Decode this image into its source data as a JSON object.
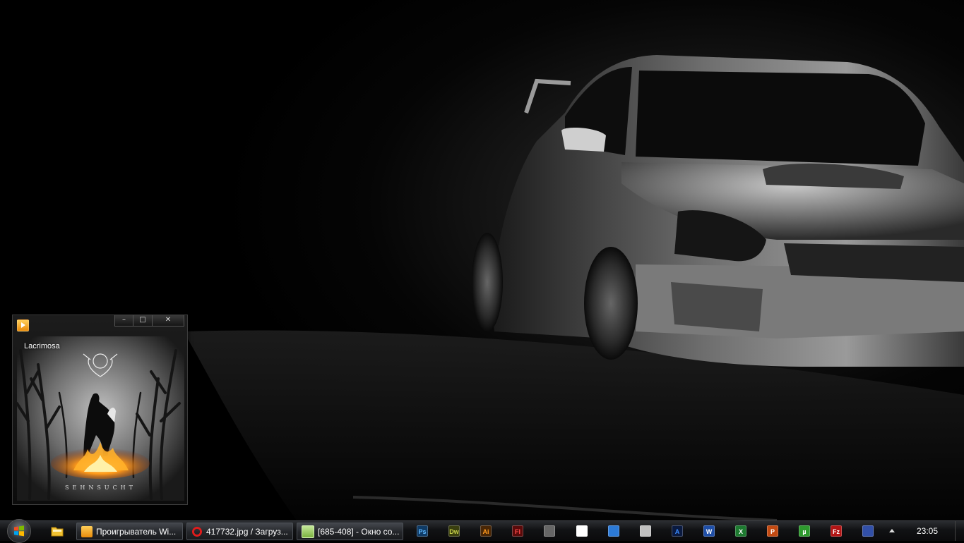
{
  "player": {
    "artist": "Lacrimosa",
    "album_title": "SEHNSUCHT",
    "controls": {
      "minimize": "–",
      "maximize": "□",
      "close": "✕"
    }
  },
  "taskbar": {
    "tasks": [
      {
        "label": "Проигрыватель Wi...",
        "icon": "media-player-icon",
        "color": "#f5a623"
      },
      {
        "label": "417732.jpg / Загруз...",
        "icon": "opera-icon",
        "color": "#e01b1b"
      },
      {
        "label": "[685-408] - Окно со...",
        "icon": "notepad-icon",
        "color": "#8bc34a"
      }
    ],
    "quick_icons": [
      {
        "name": "photoshop-icon",
        "text": "Ps",
        "bg": "#0f3b66",
        "fg": "#5fb8ff"
      },
      {
        "name": "dreamweaver-icon",
        "text": "Dw",
        "bg": "#3a3f0f",
        "fg": "#c6d04a"
      },
      {
        "name": "illustrator-icon",
        "text": "Ai",
        "bg": "#4a2706",
        "fg": "#ff9a1f"
      },
      {
        "name": "flash-icon",
        "text": "Fl",
        "bg": "#5a0a0a",
        "fg": "#ff4a4a"
      },
      {
        "name": "daemon-tools-icon",
        "text": "",
        "bg": "#666666",
        "fg": "#ffffff"
      },
      {
        "name": "picasa-icon",
        "text": "",
        "bg": "#ffffff",
        "fg": "#000000"
      },
      {
        "name": "network-globe-icon",
        "text": "",
        "bg": "#2c7ad6",
        "fg": "#ffffff"
      },
      {
        "name": "disc-burner-icon",
        "text": "",
        "bg": "#c0c0c0",
        "fg": "#000000"
      },
      {
        "name": "font-app-icon",
        "text": "A",
        "bg": "#0a1a40",
        "fg": "#3b8cff"
      },
      {
        "name": "word-icon",
        "text": "W",
        "bg": "#1f4fa8",
        "fg": "#ffffff"
      },
      {
        "name": "excel-icon",
        "text": "X",
        "bg": "#1d7a30",
        "fg": "#ffffff"
      },
      {
        "name": "powerpoint-icon",
        "text": "P",
        "bg": "#c24a12",
        "fg": "#ffffff"
      },
      {
        "name": "utorrent-icon",
        "text": "µ",
        "bg": "#2e9a2e",
        "fg": "#ffffff"
      },
      {
        "name": "filezilla-icon",
        "text": "Fz",
        "bg": "#b31515",
        "fg": "#ffffff"
      },
      {
        "name": "save-floppy-icon",
        "text": "",
        "bg": "#3250a8",
        "fg": "#ffffff"
      }
    ],
    "clock": "23:05"
  }
}
